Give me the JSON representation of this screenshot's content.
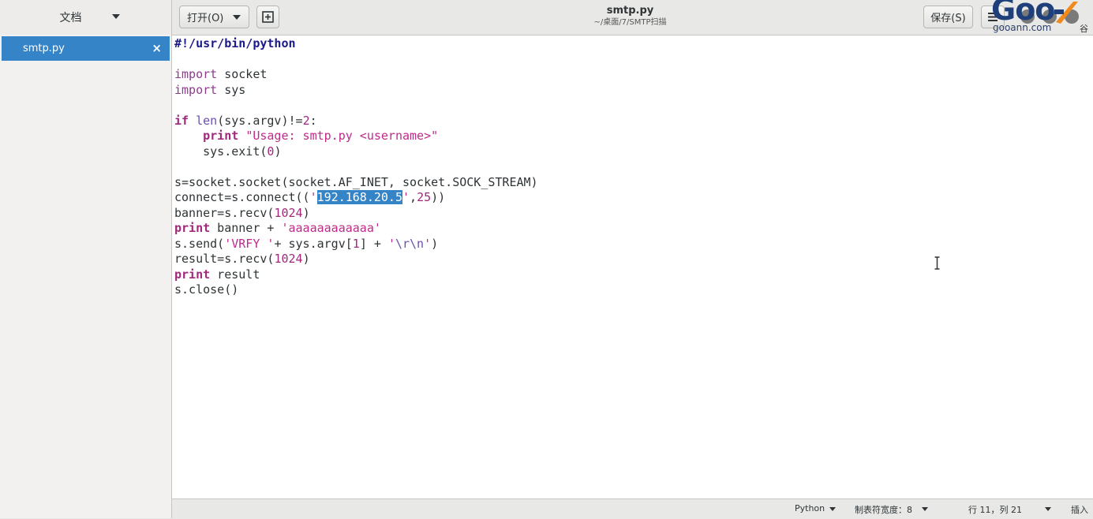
{
  "sidebar": {
    "title": "文档",
    "documents": [
      {
        "label": "smtp.py",
        "close": "×"
      }
    ]
  },
  "header": {
    "open_label": "打开(O)",
    "title": "smtp.py",
    "subtitle": "~/桌面/7/SMTP扫描",
    "save_label": "保存(S)"
  },
  "watermark": {
    "big": "Goo",
    "small": "gooann.com",
    "cn": "谷"
  },
  "editor": {
    "lines": [
      [
        {
          "t": "#!/usr/bin/python",
          "c": "k-shebang"
        }
      ],
      [],
      [
        {
          "t": "import",
          "c": "k-import"
        },
        {
          "t": " socket"
        }
      ],
      [
        {
          "t": "import",
          "c": "k-import"
        },
        {
          "t": " sys"
        }
      ],
      [],
      [
        {
          "t": "if",
          "c": "k-kw"
        },
        {
          "t": " "
        },
        {
          "t": "len",
          "c": "k-builtin"
        },
        {
          "t": "(sys.argv)!="
        },
        {
          "t": "2",
          "c": "k-num"
        },
        {
          "t": ":"
        }
      ],
      [
        {
          "t": "    "
        },
        {
          "t": "print",
          "c": "k-kw"
        },
        {
          "t": " "
        },
        {
          "t": "\"Usage: smtp.py <username>\"",
          "c": "k-str"
        }
      ],
      [
        {
          "t": "    sys.exit("
        },
        {
          "t": "0",
          "c": "k-num"
        },
        {
          "t": ")"
        }
      ],
      [],
      [
        {
          "t": "s=socket.socket(socket.AF_INET, socket.SOCK_STREAM)"
        }
      ],
      [
        {
          "t": "connect=s.connect(("
        },
        {
          "t": "'",
          "c": "k-str"
        },
        {
          "t": "192.168.20.5",
          "c": "sel"
        },
        {
          "t": "'",
          "c": "k-str"
        },
        {
          "t": ","
        },
        {
          "t": "25",
          "c": "k-num"
        },
        {
          "t": "))"
        }
      ],
      [
        {
          "t": "banner=s.recv("
        },
        {
          "t": "1024",
          "c": "k-num"
        },
        {
          "t": ")"
        }
      ],
      [
        {
          "t": "print",
          "c": "k-kw"
        },
        {
          "t": " banner + "
        },
        {
          "t": "'aaaaaaaaaaaa'",
          "c": "k-str"
        }
      ],
      [
        {
          "t": "s.send("
        },
        {
          "t": "'VRFY '",
          "c": "k-str"
        },
        {
          "t": "+ sys.argv["
        },
        {
          "t": "1",
          "c": "k-num"
        },
        {
          "t": "] + "
        },
        {
          "t": "'",
          "c": "k-str"
        },
        {
          "t": "\\r\\n",
          "c": "k-builtin"
        },
        {
          "t": "'",
          "c": "k-str"
        },
        {
          "t": ")"
        }
      ],
      [
        {
          "t": "result=s.recv("
        },
        {
          "t": "1024",
          "c": "k-num"
        },
        {
          "t": ")"
        }
      ],
      [
        {
          "t": "print",
          "c": "k-kw"
        },
        {
          "t": " result"
        }
      ],
      [
        {
          "t": "s.close()"
        }
      ]
    ]
  },
  "statusbar": {
    "language": "Python",
    "tab_width": "制表符宽度：8",
    "position": "行 11，列 21",
    "mode": "插入"
  },
  "colors": {
    "accent": "#3584c8",
    "keyword": "#a0287a",
    "string": "#c02a8a"
  }
}
